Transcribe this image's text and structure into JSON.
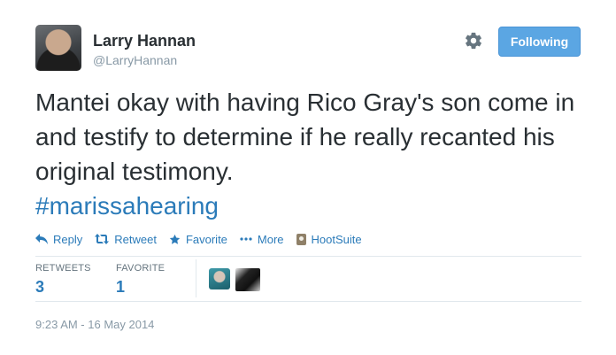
{
  "author": {
    "name": "Larry Hannan",
    "handle": "@LarryHannan"
  },
  "follow_button": {
    "label": "Following"
  },
  "tweet": {
    "text": "Mantei okay with having Rico Gray's son come in and testify to determine if he really recanted his original testimony.",
    "hashtag": "#marissahearing"
  },
  "actions": {
    "reply": "Reply",
    "retweet": "Retweet",
    "favorite": "Favorite",
    "more": "More",
    "hootsuite": "HootSuite"
  },
  "stats": {
    "retweets_label": "RETWEETS",
    "retweets_count": "3",
    "favorites_label": "FAVORITE",
    "favorites_count": "1"
  },
  "timestamp": "9:23 AM - 16 May 2014",
  "colors": {
    "link": "#2b7bb9",
    "follow_bg": "#5ba6e3",
    "muted": "#8899a6"
  },
  "icons": [
    "gear-icon",
    "reply-icon",
    "retweet-icon",
    "favorite-star-icon",
    "more-dots-icon",
    "hootsuite-icon"
  ]
}
